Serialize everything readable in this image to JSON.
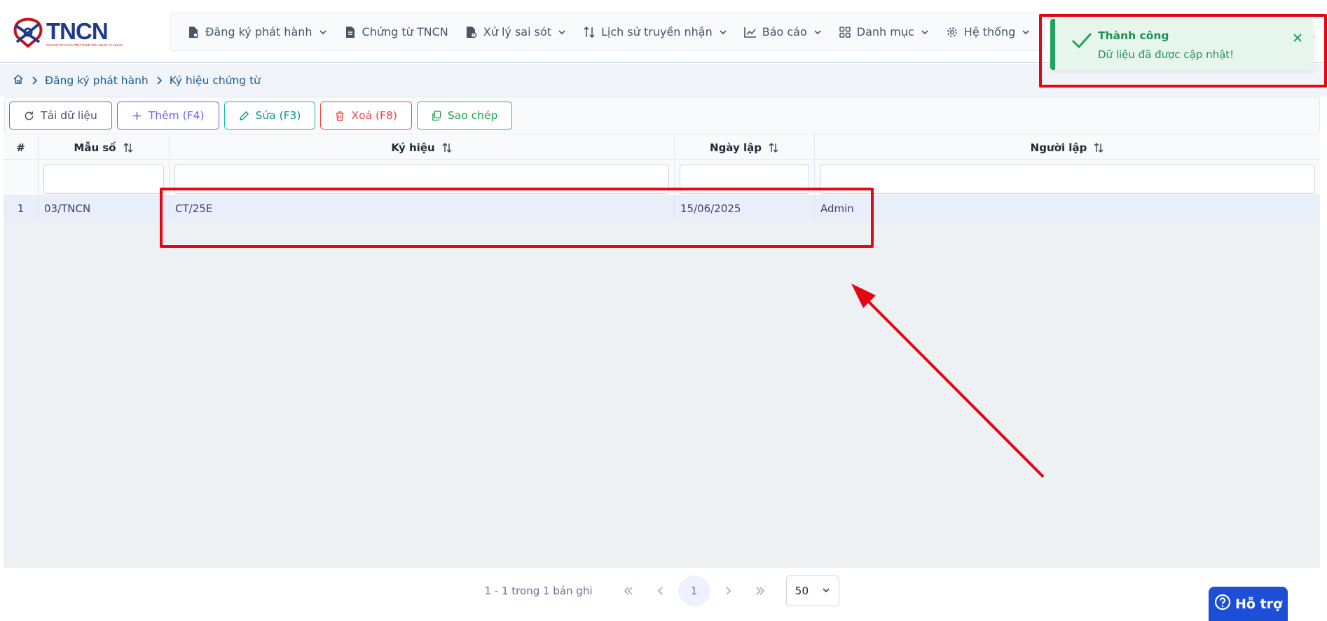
{
  "brand": {
    "name": "TNCN",
    "tagline": "CHỨNG TỪ KHẤU TRỪ THUẾ THU NHẬP CÁ NHÂN"
  },
  "nav": {
    "items": [
      {
        "label": "Đăng ký phát hành",
        "icon": "file-settings-icon",
        "has_menu": true
      },
      {
        "label": "Chứng từ TNCN",
        "icon": "file-document-icon",
        "has_menu": false
      },
      {
        "label": "Xử lý sai sót",
        "icon": "file-error-icon",
        "has_menu": true
      },
      {
        "label": "Lịch sử truyền nhận",
        "icon": "arrows-up-down-icon",
        "has_menu": true
      },
      {
        "label": "Báo cáo",
        "icon": "chart-line-icon",
        "has_menu": true
      },
      {
        "label": "Danh mục",
        "icon": "grid-icon",
        "has_menu": true
      },
      {
        "label": "Hệ thống",
        "icon": "gear-icon",
        "has_menu": true
      }
    ]
  },
  "breadcrumb": {
    "home_icon": "home-icon",
    "items": [
      "Đăng ký phát hành",
      "Ký hiệu chứng từ"
    ]
  },
  "toolbar": {
    "reload": "Tải dữ liệu",
    "add": "Thêm (F4)",
    "edit": "Sửa (F3)",
    "delete": "Xoá (F8)",
    "copy": "Sao chép"
  },
  "table": {
    "columns": [
      "#",
      "Mẫu số",
      "Ký hiệu",
      "Ngày lập",
      "Người lập"
    ],
    "rows": [
      {
        "index": "1",
        "mau_so": "03/TNCN",
        "ky_hieu": "CT/25E",
        "ngay_lap": "15/06/2025",
        "nguoi_lap": "Admin"
      }
    ]
  },
  "pagination": {
    "info": "1 - 1 trong 1 bản ghi",
    "current_page": "1",
    "page_size": "50"
  },
  "toast": {
    "title": "Thành công",
    "message": "Dữ liệu đã được cập nhật!"
  },
  "help": {
    "label": "Hỗ trợ"
  },
  "colors": {
    "brand_blue": "#1e3a8a",
    "brand_red": "#c2151b",
    "success": "#1fa35f",
    "annotation": "#e30613"
  }
}
